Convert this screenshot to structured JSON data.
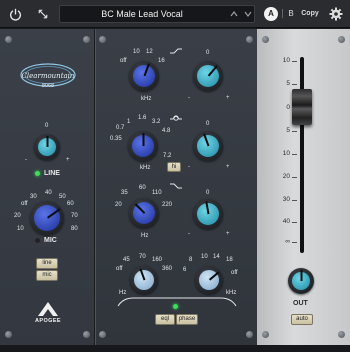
{
  "topbar": {
    "power_icon": "power-icon",
    "expand_icon": "expand-icon",
    "preset_name": "BC Male Lead Vocal",
    "prev_icon": "chevron-up-icon",
    "next_icon": "chevron-down-icon",
    "compare_a": "A",
    "compare_sep": "|",
    "compare_b": "B",
    "copy_label": "Copy",
    "settings_icon": "gear-icon"
  },
  "input_section": {
    "logo_text": "Clearmountain",
    "model_number": "8068",
    "line_knob": {
      "label": "LINE",
      "scale": [
        "0",
        "-",
        "+"
      ],
      "value": "0"
    },
    "mic_knob": {
      "label": "MIC",
      "scale": [
        "30",
        "40",
        "50",
        "60",
        "off",
        "20",
        "70",
        "10",
        "80"
      ]
    },
    "line_mic_toggle": {
      "line_label": "line",
      "mic_label": "mic"
    },
    "brand": "APOGEE",
    "colors": {
      "line_led": "#3ddc5a",
      "mic_led": "#222222"
    }
  },
  "eq_section": {
    "band1": {
      "freq_scale": [
        "off",
        "10",
        "12",
        "16"
      ],
      "freq_unit": "kHz",
      "gain_scale": [
        "0",
        "-",
        "+"
      ]
    },
    "band2": {
      "freq_scale": [
        "0.7",
        "1",
        "1.6",
        "3.2",
        "4.8",
        "0.35",
        "7.2"
      ],
      "freq_unit": "kHz",
      "hi_button": "hi",
      "gain_scale": [
        "0",
        "-",
        "+"
      ]
    },
    "band3": {
      "freq_scale": [
        "35",
        "60",
        "110",
        "20",
        "220"
      ],
      "freq_unit": "Hz",
      "gain_scale": [
        "0",
        "-",
        "+"
      ]
    },
    "filters": {
      "hp_scale": [
        "45",
        "70",
        "160",
        "off",
        "360"
      ],
      "hp_unit": "Hz",
      "lp_scale": [
        "8",
        "10",
        "14",
        "18",
        "6",
        "off"
      ],
      "lp_unit": "kHz",
      "eql_button": "eql",
      "phase_button": "phase",
      "colors": {
        "filter_led": "#3ddc5a"
      }
    }
  },
  "output_section": {
    "fader_scale": [
      "10",
      "5",
      "0",
      "5",
      "10",
      "20",
      "30",
      "40",
      "∞"
    ],
    "out_label": "OUT",
    "auto_button": "auto"
  }
}
